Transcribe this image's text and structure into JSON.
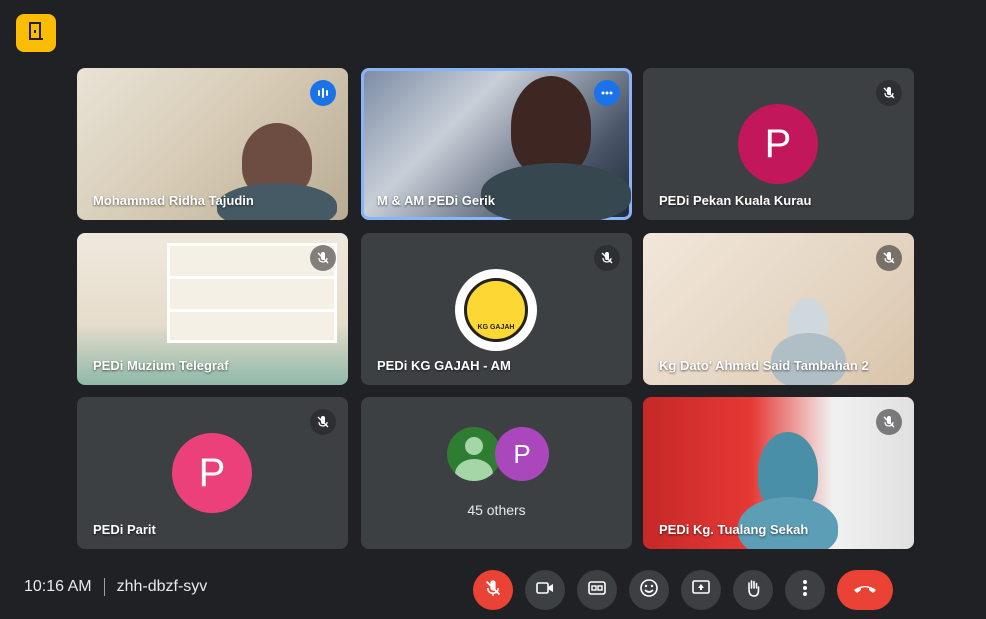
{
  "meeting": {
    "time": "10:16 AM",
    "code": "zhh-dbzf-syv"
  },
  "tiles": [
    {
      "name": "Mohammad Ridha Tajudin",
      "status": "speaking"
    },
    {
      "name": "M & AM PEDi Gerik",
      "status": "pinned-active"
    },
    {
      "name": "PEDi Pekan Kuala Kurau",
      "status": "muted",
      "avatar_letter": "P",
      "avatar_color": "#c2185b"
    },
    {
      "name": "PEDi Muzium Telegraf",
      "status": "muted"
    },
    {
      "name": "PEDi KG GAJAH - AM",
      "status": "muted",
      "logo_text": "KG GAJAH"
    },
    {
      "name": "Kg Dato' Ahmad Said Tambahan 2",
      "status": "muted"
    },
    {
      "name": "PEDi Parit",
      "status": "muted",
      "avatar_letter": "P",
      "avatar_color": "#ec407a"
    },
    {
      "others_label": "45 others",
      "second_avatar_letter": "P",
      "second_avatar_color": "#ab47bc"
    },
    {
      "name": "PEDi Kg. Tualang Sekah",
      "status": "muted"
    }
  ],
  "colors": {
    "background": "#202124",
    "accent": "#8ab4f8",
    "danger": "#ea4335",
    "badge": "#fbbc04"
  },
  "controls": [
    "mic-off",
    "camera",
    "captions",
    "emoji",
    "present",
    "raise-hand",
    "more-options",
    "leave-call"
  ]
}
